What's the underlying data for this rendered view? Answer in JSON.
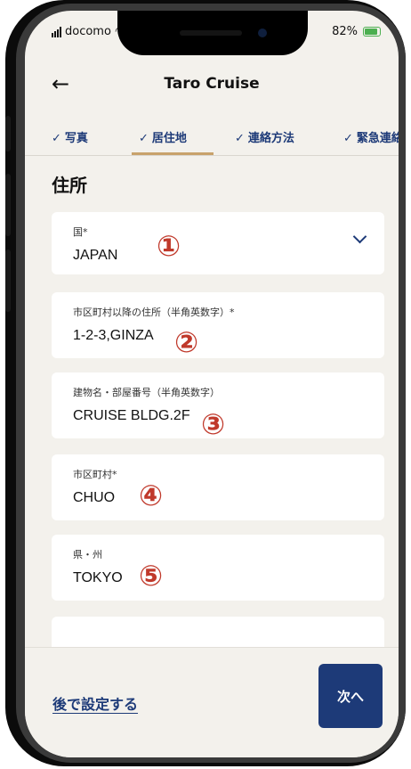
{
  "status_bar": {
    "carrier": "docomo",
    "battery": "82%"
  },
  "header": {
    "back_icon": "back-arrow-icon",
    "title": "Taro Cruise"
  },
  "tabs": [
    {
      "label": "写真",
      "check": "✓"
    },
    {
      "label": "居住地",
      "check": "✓"
    },
    {
      "label": "連絡方法",
      "check": "✓"
    },
    {
      "label": "緊急連絡",
      "check": "✓"
    }
  ],
  "section_title": "住所",
  "fields": [
    {
      "label": "国*",
      "value": "JAPAN",
      "marker": "①",
      "type": "select"
    },
    {
      "label": "市区町村以降の住所（半角英数字）*",
      "value": "1-2-3,GINZA",
      "marker": "②"
    },
    {
      "label": "建物名・部屋番号（半角英数字）",
      "value": "CRUISE BLDG.2F",
      "marker": "③"
    },
    {
      "label": "市区町村*",
      "value": "CHUO",
      "marker": "④"
    },
    {
      "label": "県・州",
      "value": "TOKYO",
      "marker": "⑤"
    }
  ],
  "footer": {
    "later_label": "後で設定する",
    "next_label": "次へ"
  },
  "colors": {
    "accent": "#1d3a78",
    "tab_underline": "#c8a26b",
    "marker": "#c0392b",
    "background": "#f3f1ec"
  }
}
